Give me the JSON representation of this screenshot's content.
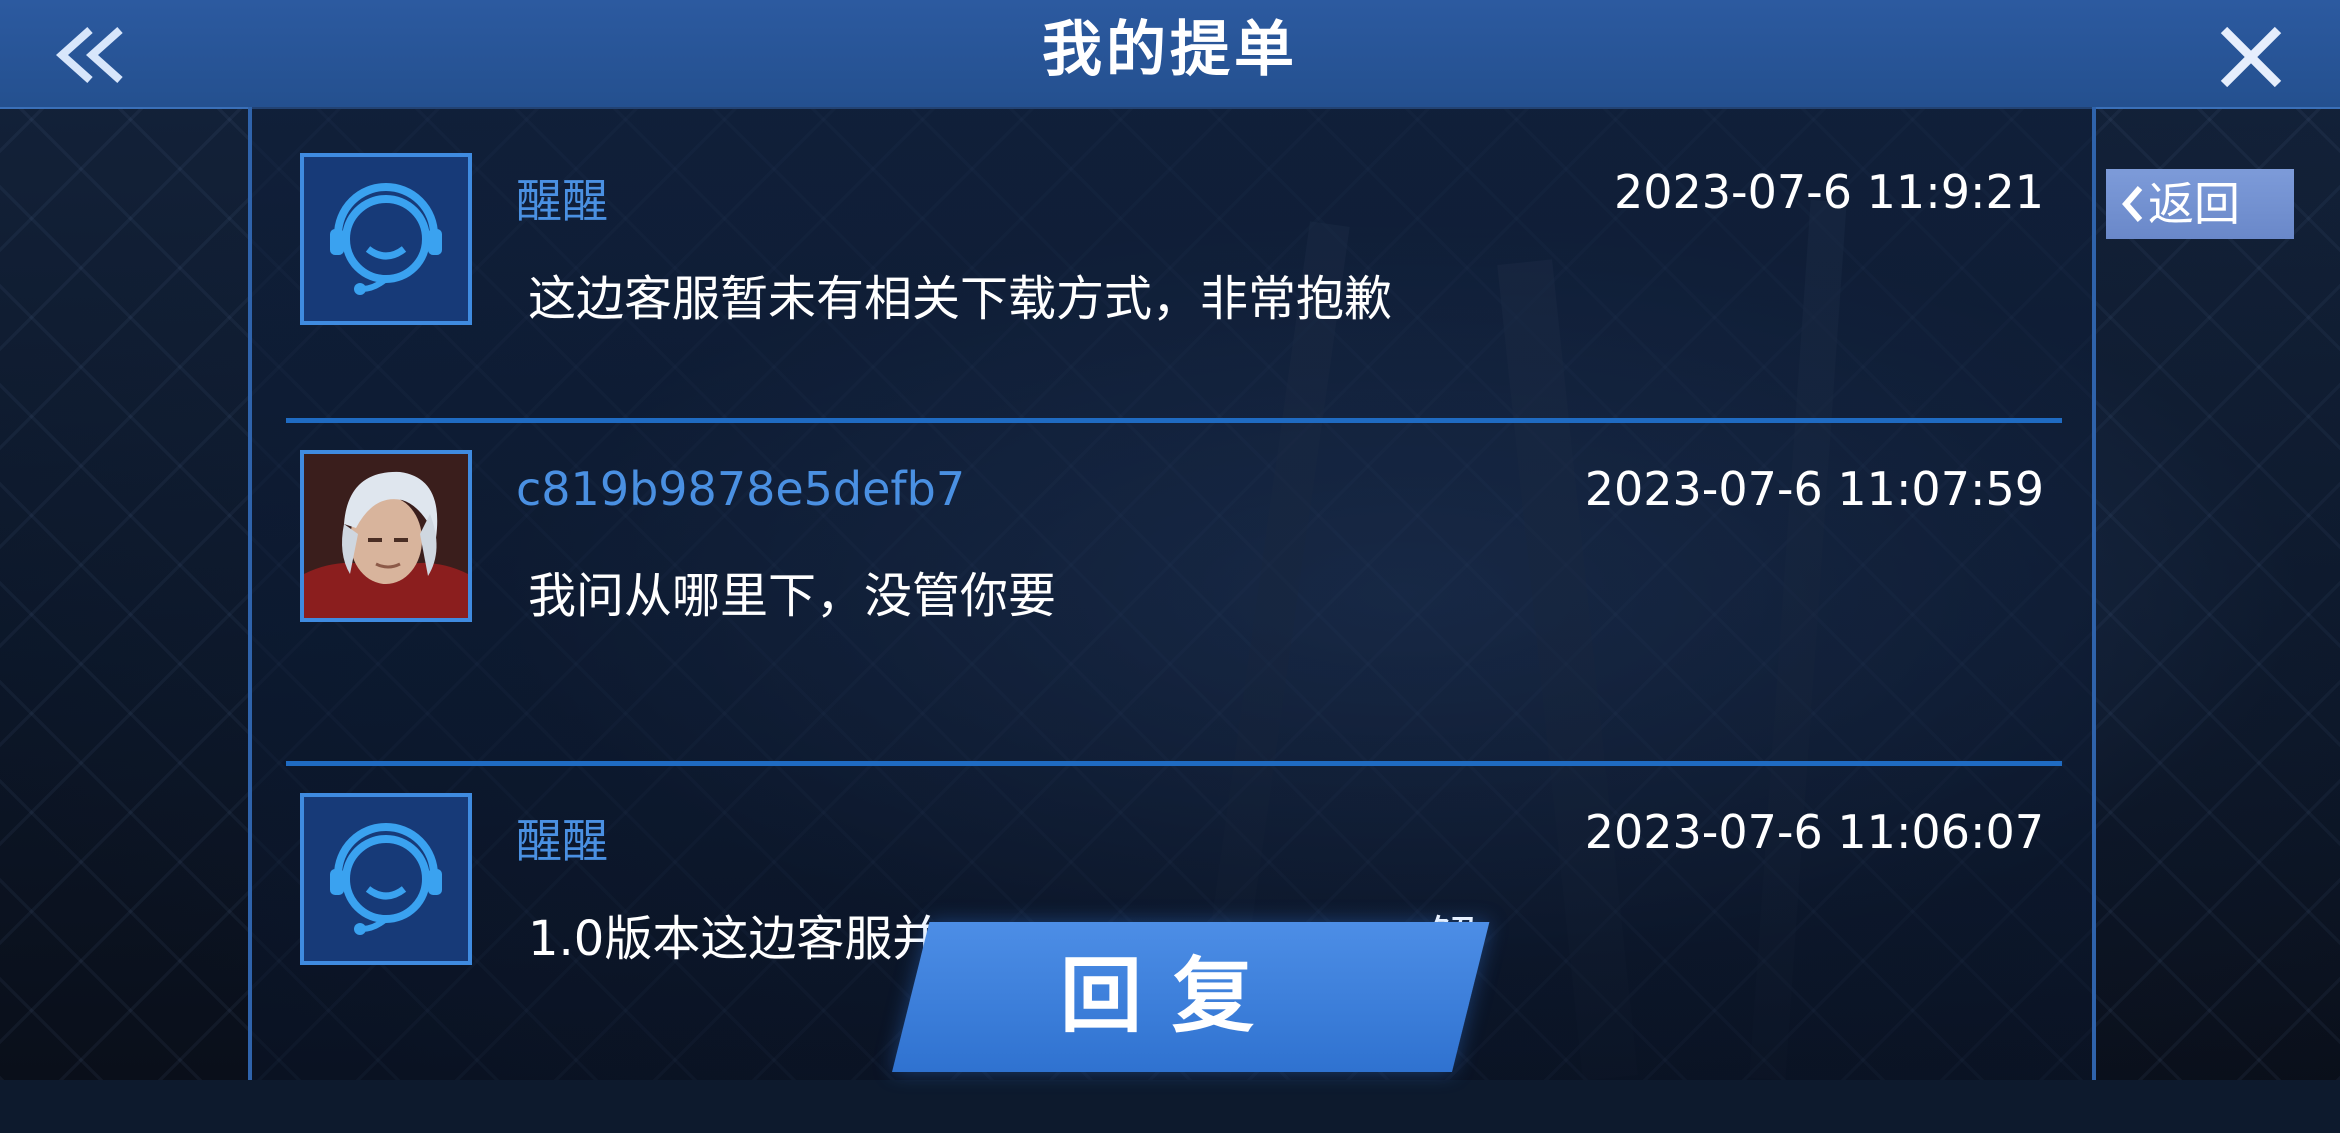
{
  "header": {
    "title": "我的提单"
  },
  "side": {
    "return_label": "返回"
  },
  "messages": [
    {
      "sender": "醒醒",
      "time": "2023-07-6 11:9:21",
      "text": "这边客服暂未有相关下载方式，非常抱歉",
      "avatar": "support-headset-icon"
    },
    {
      "sender": "c819b9878e5defb7",
      "time": "2023-07-6 11:07:59",
      "text": "我问从哪里下，没管你要",
      "avatar": "user-portrait"
    },
    {
      "sender": "醒醒",
      "time": "2023-07-6 11:06:07",
      "text": "1.0版本这边客服并",
      "text_tail": "解",
      "avatar": "support-headset-icon"
    }
  ],
  "footer": {
    "reply_label": "回复"
  },
  "colors": {
    "header": "#2c5aa0",
    "name": "#4a90e2",
    "accent": "#1f6bc2",
    "reply": "#3f82dc"
  }
}
